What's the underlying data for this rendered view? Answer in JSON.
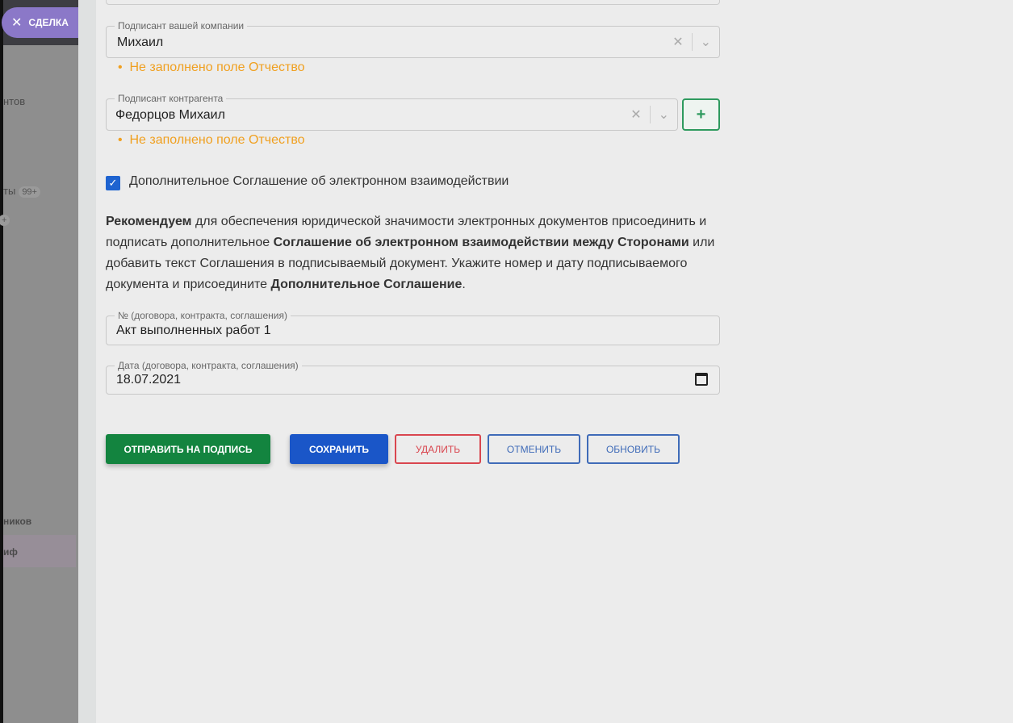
{
  "sidebar": {
    "deal_label": "СДЕЛКА",
    "items": [
      {
        "label": "нтов"
      },
      {
        "label": "ты",
        "badge": "99+"
      },
      {
        "label": "",
        "badge": "+"
      },
      {
        "label": "ников"
      },
      {
        "label": "иф"
      }
    ]
  },
  "form": {
    "signer_company": {
      "label": "Подписант вашей компании",
      "value": "Михаил",
      "error": "Не заполнено поле Отчество"
    },
    "signer_counterparty": {
      "label": "Подписант контрагента",
      "value": "Федорцов Михаил",
      "error": "Не заполнено поле Отчество",
      "add_label": "+"
    },
    "agreement_checkbox": {
      "label": "Дополнительное Соглашение об электронном взаимодействии",
      "checked": true
    },
    "recommendation": {
      "p1": "Рекомендуем",
      "p2": " для обеспечения юридической значимости электронных документов присоединить и подписать дополнительное ",
      "p3": "Соглашение об электронном взаимодействии между Сторонами",
      "p4": " или добавить текст Соглашения в подписываемый документ. Укажите номер и дату подписываемого документа и присоедините ",
      "p5": "Дополнительное Соглашение",
      "p6": "."
    },
    "number": {
      "label": "№ (договора, контракта, соглашения)",
      "value": "Акт выполненных работ 1"
    },
    "date": {
      "label": "Дата (договора, контракта, соглашения)",
      "value": "18.07.2021"
    }
  },
  "buttons": {
    "send": "ОТПРАВИТЬ НА ПОДПИСЬ",
    "save": "СОХРАНИТЬ",
    "delete": "УДАЛИТЬ",
    "cancel": "ОТМЕНИТЬ",
    "refresh": "ОБНОВИТЬ"
  },
  "colors": {
    "green": "#13843f",
    "blue": "#1a56c8",
    "red": "#d9464f",
    "warning": "#f0a020",
    "purple": "#8b78c8"
  }
}
